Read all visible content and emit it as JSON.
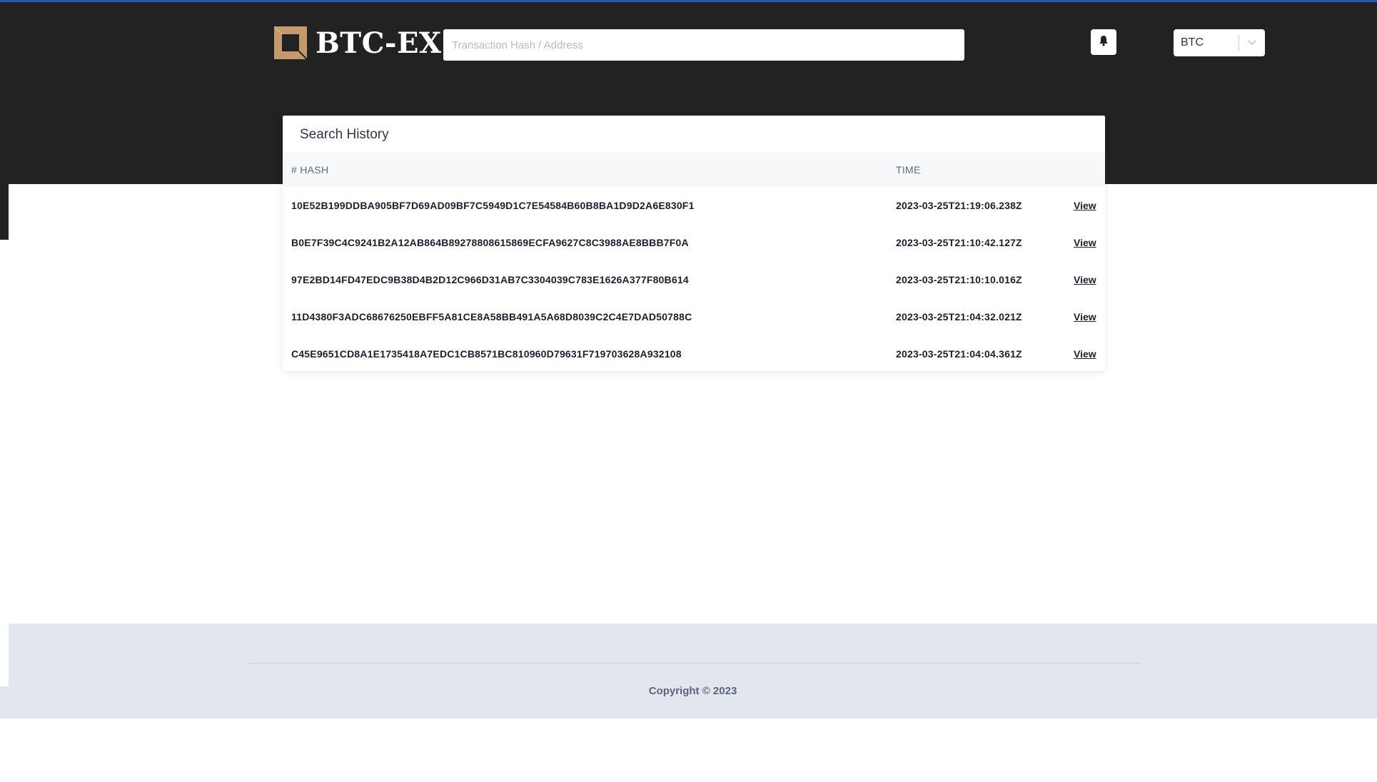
{
  "header": {
    "brand": "BTC-EX",
    "search_placeholder": "Transaction Hash / Address",
    "notification_icon": "bell-icon",
    "coin_select_value": "BTC",
    "coin_select_icon": "chevron-down-icon"
  },
  "search_history": {
    "title": "Search History",
    "columns": {
      "hash": "# HASH",
      "time": "TIME"
    },
    "rows": [
      {
        "hash": "10E52B199DDBA905BF7D69AD09BF7C5949D1C7E54584B60B8BA1D9D2A6E830F1",
        "time": "2023-03-25T21:19:06.238Z",
        "action": "View"
      },
      {
        "hash": "B0E7F39C4C9241B2A12AB864B89278808615869ECFA9627C8C3988AE8BBB7F0A",
        "time": "2023-03-25T21:10:42.127Z",
        "action": "View"
      },
      {
        "hash": "97E2BD14FD47EDC9B38D4B2D12C966D31AB7C3304039C783E1626A377F80B614",
        "time": "2023-03-25T21:10:10.016Z",
        "action": "View"
      },
      {
        "hash": "11D4380F3ADC68676250EBFF5A81CE8A58BB491A5A68D8039C2C4E7DAD50788C",
        "time": "2023-03-25T21:04:32.021Z",
        "action": "View"
      },
      {
        "hash": "C45E9651CD8A1E1735418A7EDC1CB8571BC810960D79631F719703628A932108",
        "time": "2023-03-25T21:04:04.361Z",
        "action": "View"
      }
    ]
  },
  "footer": {
    "copyright": "Copyright © 2023"
  },
  "colors": {
    "header_bg": "#222222",
    "accent_border": "#2f56b0",
    "logo_tan": "#c49a6c",
    "footer_bg": "#e1e6ef"
  }
}
